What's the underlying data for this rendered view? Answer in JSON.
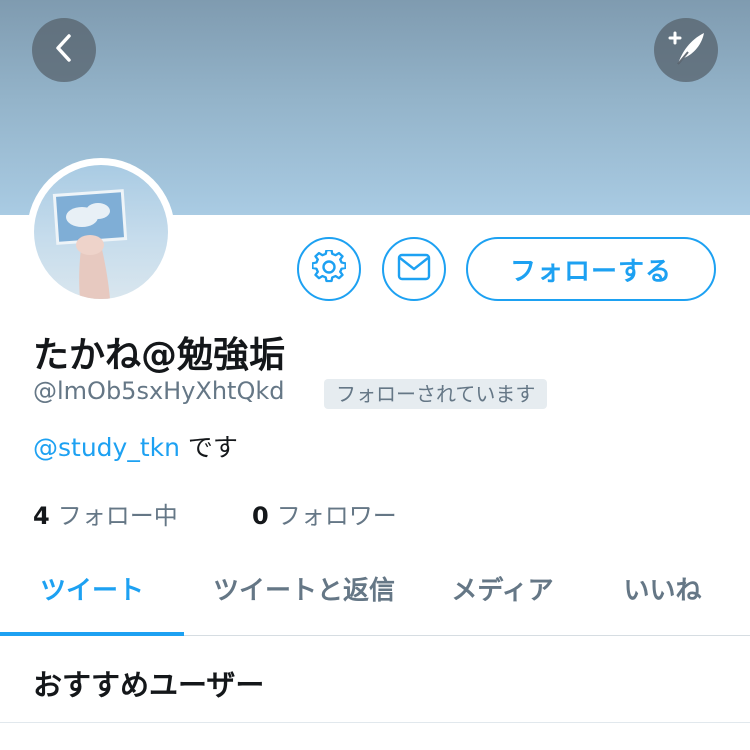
{
  "header": {
    "back_icon": "chevron-left-icon",
    "compose_icon": "quill-plus-icon",
    "banner_color": "#a9cbe3"
  },
  "profile": {
    "display_name": "たかね@勉強垢",
    "handle": "@lmOb5sxHyXhtQkd",
    "follows_you_badge": "フォローされています",
    "bio_mention": "@study_tkn",
    "bio_text": " です",
    "following_count": "4",
    "following_label": "フォロー中",
    "followers_count": "0",
    "followers_label": "フォロワー"
  },
  "actions": {
    "settings_icon": "gear-icon",
    "message_icon": "envelope-icon",
    "follow_label": "フォローする"
  },
  "tabs": [
    {
      "label": "ツイート"
    },
    {
      "label": "ツイートと返信"
    },
    {
      "label": "メディア"
    },
    {
      "label": "いいね"
    }
  ],
  "section": {
    "title": "おすすめユーザー"
  },
  "colors": {
    "accent": "#1da1f2",
    "text_primary": "#14171a",
    "text_secondary": "#657786"
  }
}
